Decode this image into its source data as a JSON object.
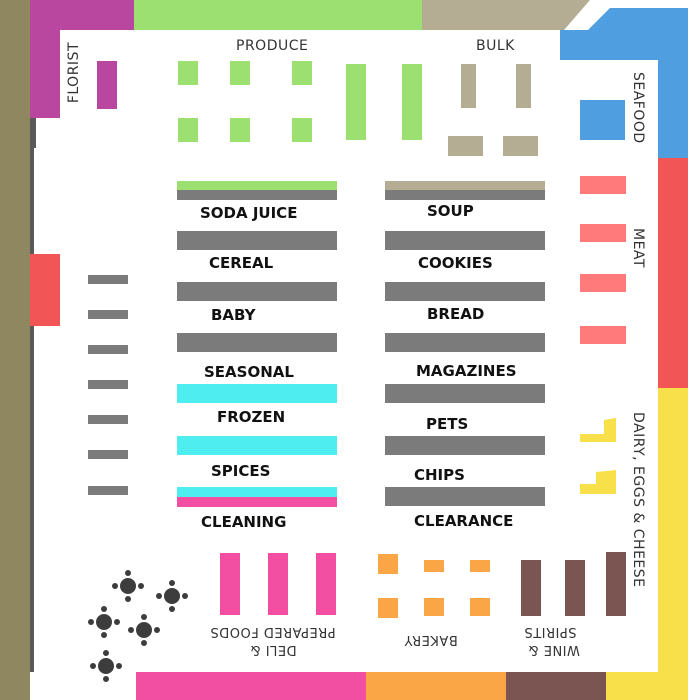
{
  "departments": {
    "florist": "FLORIST",
    "produce": "PRODUCE",
    "bulk": "BULK",
    "seafood": "SEAFOOD",
    "meat": "MEAT",
    "dairy": "DAIRY, EGGS & CHEESE",
    "deli": "DELI & PREPARED FOODS",
    "bakery": "BAKERY",
    "wine": "WINE & SPIRITS"
  },
  "aisles_left": [
    "SODA JUICE",
    "CEREAL",
    "BABY",
    "SEASONAL",
    "FROZEN",
    "SPICES",
    "CLEANING"
  ],
  "aisles_right": [
    "SOUP",
    "COOKIES",
    "BREAD",
    "MAGAZINES",
    "PETS",
    "CHIPS",
    "CLEARANCE"
  ],
  "colors": {
    "florist": "#b9479f",
    "produce": "#9be070",
    "bulk": "#b5ac94",
    "seafood": "#4f9fe0",
    "meat": "#f25555",
    "meat_light": "#ff7b7b",
    "dairy": "#f8e04a",
    "deli": "#f24fa3",
    "bakery": "#fba646",
    "wine": "#7a5551",
    "shelf": "#7b7b7b",
    "frozen": "#4eeef0",
    "olive": "#8e8760",
    "seating": "#3d3d3d"
  }
}
